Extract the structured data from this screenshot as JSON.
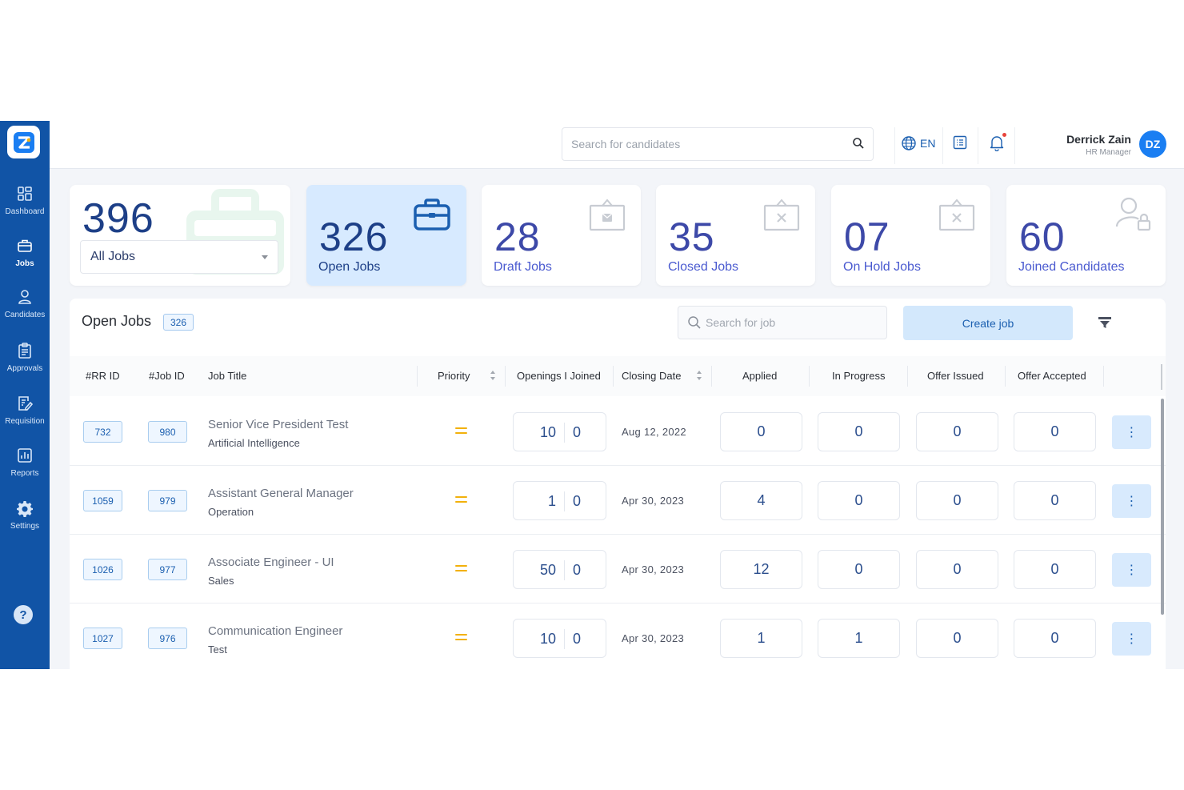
{
  "sidebar": {
    "items": [
      {
        "label": "Dashboard",
        "icon": "dashboard-icon"
      },
      {
        "label": "Jobs",
        "icon": "briefcase-icon"
      },
      {
        "label": "Candidates",
        "icon": "user-icon"
      },
      {
        "label": "Approvals",
        "icon": "clipboard-icon"
      },
      {
        "label": "Requisition",
        "icon": "edit-document-icon"
      },
      {
        "label": "Reports",
        "icon": "bar-chart-icon"
      },
      {
        "label": "Settings",
        "icon": "gear-icon"
      }
    ],
    "active": "Jobs",
    "help": "?"
  },
  "topbar": {
    "search_placeholder": "Search for candidates",
    "language": "EN",
    "user_name": "Derrick Zain",
    "user_role": "HR Manager",
    "avatar_initials": "DZ"
  },
  "stats": {
    "all": {
      "value": "396",
      "select_value": "All Jobs"
    },
    "open": {
      "value": "326",
      "label": "Open Jobs"
    },
    "draft": {
      "value": "28",
      "label": "Draft Jobs"
    },
    "closed": {
      "value": "35",
      "label": "Closed Jobs"
    },
    "hold": {
      "value": "07",
      "label": "On Hold Jobs"
    },
    "joined": {
      "value": "60",
      "label": "Joined Candidates"
    }
  },
  "jobs_panel": {
    "title": "Open Jobs",
    "count": "326",
    "search_placeholder": "Search for job",
    "create_label": "Create job",
    "columns": {
      "rr_id": "#RR ID",
      "job_id": "#Job ID",
      "title": "Job Title",
      "priority": "Priority",
      "openings": "Openings I Joined",
      "closing": "Closing Date",
      "applied": "Applied",
      "progress": "In Progress",
      "offer_issued": "Offer Issued",
      "offer_accepted": "Offer Accepted"
    },
    "rows": [
      {
        "rr_id": "732",
        "job_id": "980",
        "title": "Senior Vice President Test",
        "dept": "Artificial Intelligence",
        "openings": "10",
        "joined": "0",
        "closing": "Aug 12, 2022",
        "applied": "0",
        "progress": "0",
        "offer_issued": "0",
        "offer_accepted": "0"
      },
      {
        "rr_id": "1059",
        "job_id": "979",
        "title": "Assistant General Manager",
        "dept": "Operation",
        "openings": "1",
        "joined": "0",
        "closing": "Apr 30, 2023",
        "applied": "4",
        "progress": "0",
        "offer_issued": "0",
        "offer_accepted": "0"
      },
      {
        "rr_id": "1026",
        "job_id": "977",
        "title": "Associate Engineer - UI",
        "dept": "Sales",
        "openings": "50",
        "joined": "0",
        "closing": "Apr 30, 2023",
        "applied": "12",
        "progress": "0",
        "offer_issued": "0",
        "offer_accepted": "0"
      },
      {
        "rr_id": "1027",
        "job_id": "976",
        "title": "Communication Engineer",
        "dept": "Test",
        "openings": "10",
        "joined": "0",
        "closing": "Apr 30, 2023",
        "applied": "1",
        "progress": "1",
        "offer_issued": "0",
        "offer_accepted": "0"
      }
    ],
    "more_glyph": "⋮"
  },
  "colors": {
    "sidebar": "#1154a6",
    "accent": "#1b5fb0",
    "active_card": "#d7eaff",
    "priority": "#f2b10c"
  }
}
